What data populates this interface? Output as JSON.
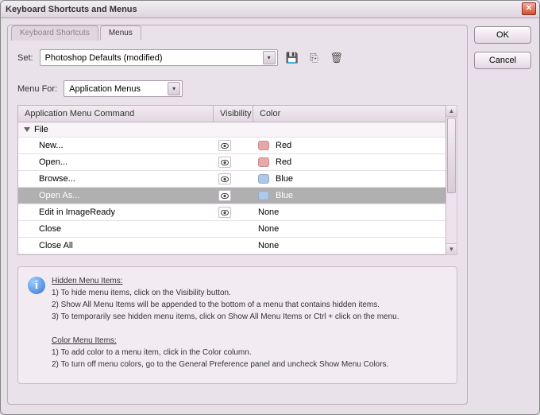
{
  "title": "Keyboard Shortcuts and Menus",
  "buttons": {
    "ok": "OK",
    "cancel": "Cancel"
  },
  "tabs": {
    "shortcuts": "Keyboard Shortcuts",
    "menus": "Menus",
    "active": "menus"
  },
  "set": {
    "label": "Set:",
    "value": "Photoshop Defaults (modified)"
  },
  "menuFor": {
    "label": "Menu For:",
    "value": "Application Menus"
  },
  "grid": {
    "headers": {
      "command": "Application Menu Command",
      "visibility": "Visibility",
      "color": "Color"
    },
    "group": "File",
    "rows": [
      {
        "cmd": "New...",
        "visible": true,
        "color": "Red",
        "swatch": "red",
        "selected": false
      },
      {
        "cmd": "Open...",
        "visible": true,
        "color": "Red",
        "swatch": "red",
        "selected": false
      },
      {
        "cmd": "Browse...",
        "visible": true,
        "color": "Blue",
        "swatch": "blue",
        "selected": false
      },
      {
        "cmd": "Open As...",
        "visible": true,
        "color": "Blue",
        "swatch": "blue",
        "selected": true
      },
      {
        "cmd": "Edit in ImageReady",
        "visible": true,
        "color": "None",
        "swatch": "",
        "selected": false
      },
      {
        "cmd": "Close",
        "visible": false,
        "color": "None",
        "swatch": "",
        "selected": false
      },
      {
        "cmd": "Close All",
        "visible": false,
        "color": "None",
        "swatch": "",
        "selected": false
      }
    ]
  },
  "info": {
    "hiddenHead": "Hidden Menu Items:",
    "hidden1": "1) To hide menu items, click on the Visibility button.",
    "hidden2": "2) Show All Menu Items will be appended to the bottom of a menu that contains hidden items.",
    "hidden3": "3) To temporarily see hidden menu items, click on Show All Menu Items or Ctrl + click on the menu.",
    "colorHead": "Color Menu Items:",
    "color1": "1) To add color to a menu item, click in the Color column.",
    "color2": "2) To turn off menu colors, go to the General Preference panel and uncheck Show Menu Colors."
  }
}
